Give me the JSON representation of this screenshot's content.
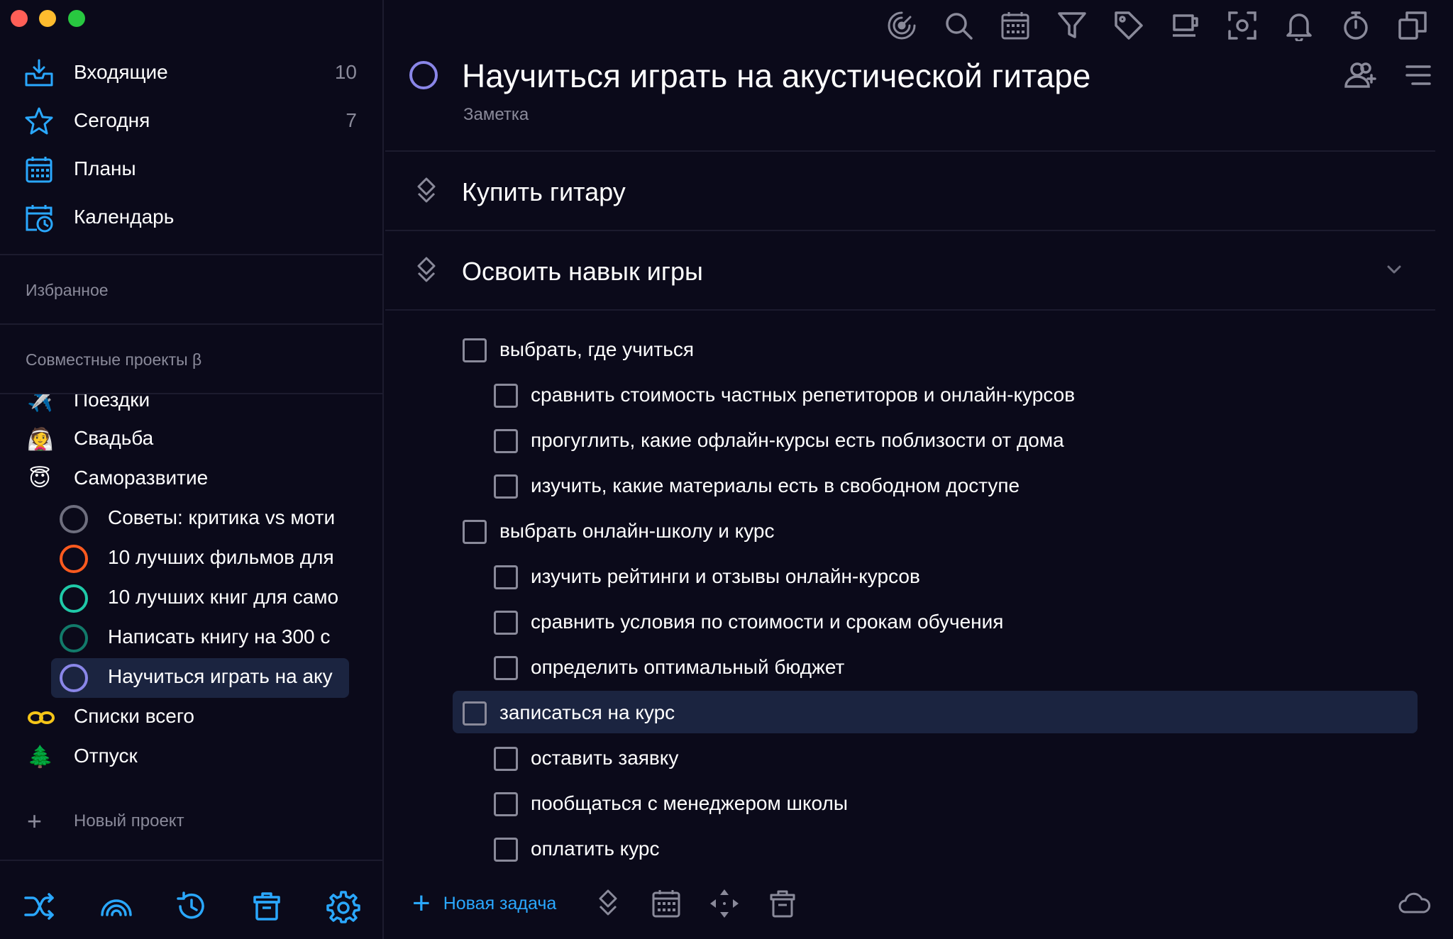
{
  "colors": {
    "background": "#0b0a1a",
    "accent_blue": "#2aa8ff",
    "selected_row": "#1b2440",
    "muted_text": "#8a8a9a",
    "task_circle": "#8a86e8"
  },
  "window_controls": [
    "close",
    "minimize",
    "maximize"
  ],
  "sidebar": {
    "nav": [
      {
        "icon": "inbox-icon",
        "label": "Входящие",
        "count": "10"
      },
      {
        "icon": "star-icon",
        "label": "Сегодня",
        "count": "7"
      },
      {
        "icon": "calendar-grid-icon",
        "label": "Планы",
        "count": ""
      },
      {
        "icon": "calendar-clock-icon",
        "label": "Календарь",
        "count": ""
      }
    ],
    "favorites_title": "Избранное",
    "shared_title": "Совместные проекты β",
    "projects": [
      {
        "emoji": "✈️",
        "label": "Поездки"
      },
      {
        "emoji": "👰",
        "label": "Свадьба"
      },
      {
        "emoji": "😇",
        "label": "Саморазвитие"
      }
    ],
    "subprojects": [
      {
        "label": "Советы: критика vs моти",
        "ring_color": "#6e6e7e",
        "selected": false
      },
      {
        "label": "10 лучших фильмов для",
        "ring_color": "#ff5a1f",
        "selected": false
      },
      {
        "label": "10 лучших книг для само",
        "ring_color": "#1fc9a8",
        "selected": false
      },
      {
        "label": "Написать книгу на 300 с",
        "ring_color": "#127a6a",
        "selected": false
      },
      {
        "label": "Научиться играть на аку",
        "ring_color": "#8a86e8",
        "selected": true
      }
    ],
    "projects_after": [
      {
        "emoji": "♾️",
        "label": "Списки всего"
      },
      {
        "emoji": "🌲",
        "label": "Отпуск"
      }
    ],
    "new_project": "Новый проект",
    "bottom_icons": [
      "shuffle-icon",
      "rainbow-icon",
      "history-icon",
      "trash-icon",
      "settings-icon"
    ]
  },
  "toolbar": {
    "icons": [
      "focus-icon",
      "search-icon",
      "calendar-icon",
      "filter-icon",
      "tag-icon",
      "coffee-icon",
      "screenshot-icon",
      "bell-icon",
      "timer-icon",
      "copy-icon"
    ]
  },
  "task": {
    "title": "Научиться играть на акустической гитаре",
    "note": "Заметка",
    "header_icons": [
      "add-user-icon",
      "menu-icon"
    ],
    "headings": [
      {
        "label": "Купить гитару",
        "collapsible": false
      },
      {
        "label": "Освоить навык игры",
        "collapsible": true
      }
    ],
    "checklist": [
      {
        "label": "выбрать, где учиться",
        "level": 1,
        "selected": false
      },
      {
        "label": "сравнить стоимость частных репетиторов и онлайн-курсов",
        "level": 2,
        "selected": false
      },
      {
        "label": "прогуглить, какие офлайн-курсы есть поблизости от дома",
        "level": 2,
        "selected": false
      },
      {
        "label": "изучить, какие материалы есть в свободном доступе",
        "level": 2,
        "selected": false
      },
      {
        "label": "выбрать онлайн-школу и курс",
        "level": 1,
        "selected": false
      },
      {
        "label": "изучить рейтинги и отзывы онлайн-курсов",
        "level": 2,
        "selected": false
      },
      {
        "label": "сравнить условия по стоимости и срокам обучения",
        "level": 2,
        "selected": false
      },
      {
        "label": "определить оптимальный бюджет",
        "level": 2,
        "selected": false
      },
      {
        "label": "записаться на курс",
        "level": 1,
        "selected": true
      },
      {
        "label": "оставить заявку",
        "level": 2,
        "selected": false
      },
      {
        "label": "пообщаться с менеджером школы",
        "level": 2,
        "selected": false
      },
      {
        "label": "оплатить курс",
        "level": 2,
        "selected": false
      }
    ]
  },
  "bottom_bar": {
    "new_task": "Новая задача",
    "icons": [
      "heading-icon",
      "calendar-icon",
      "move-icon",
      "trash-icon",
      "cloud-icon"
    ]
  }
}
